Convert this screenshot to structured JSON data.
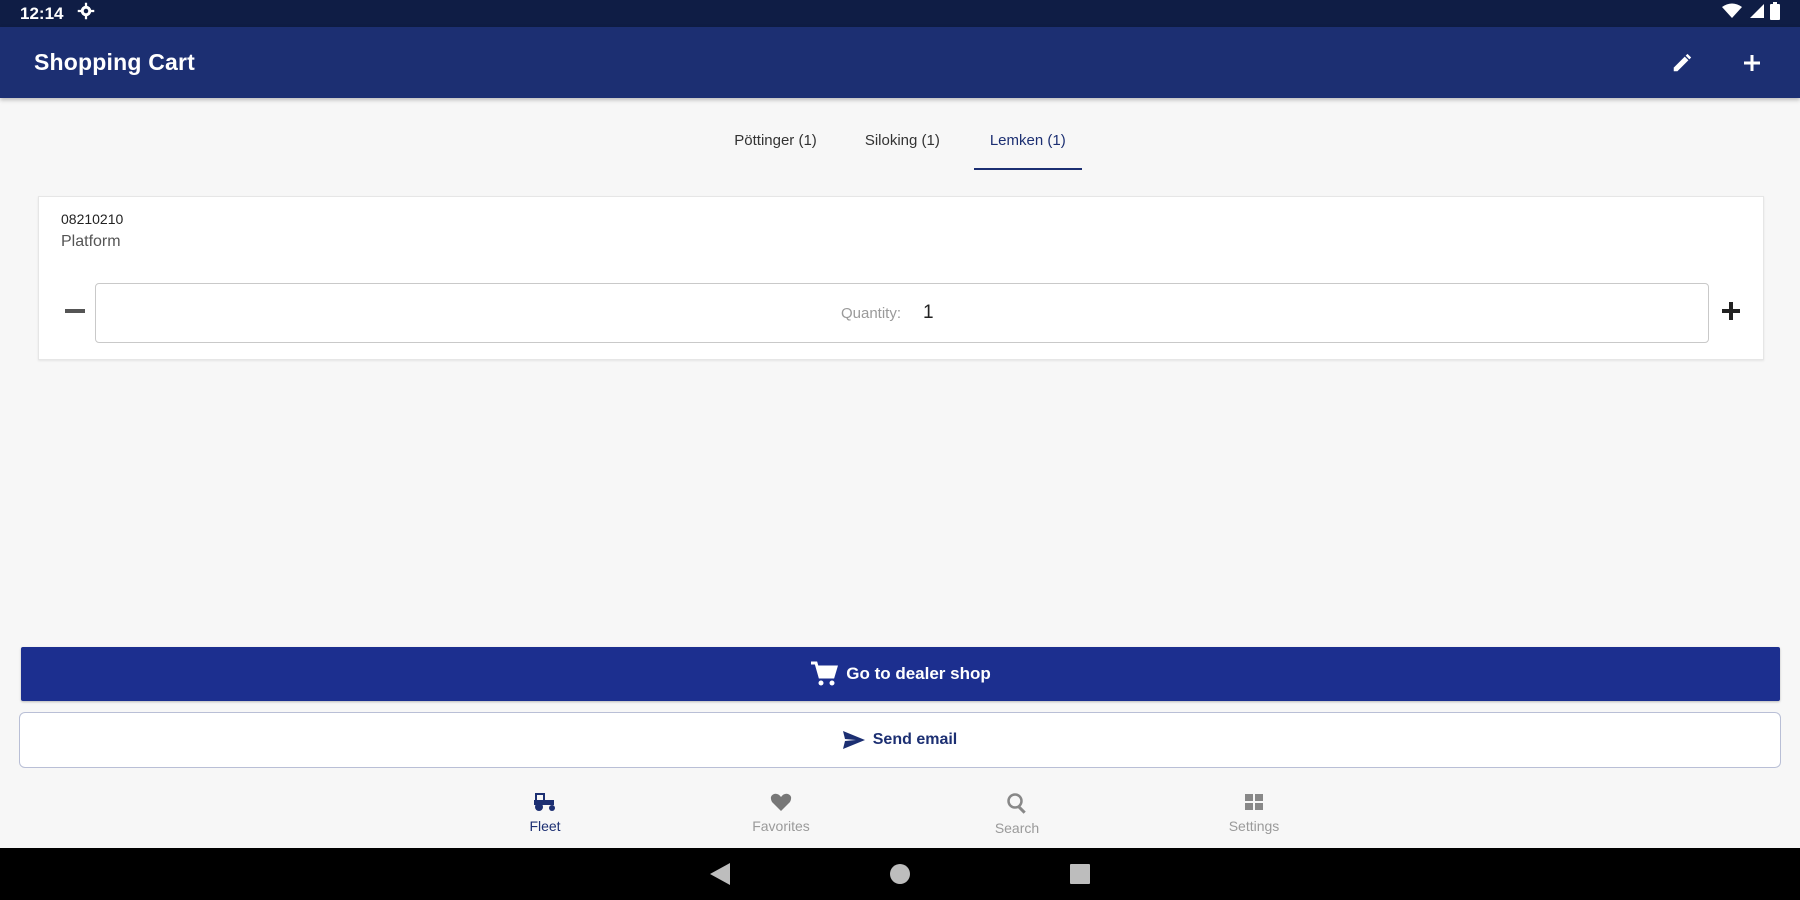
{
  "status_bar": {
    "time": "12:14",
    "settings_icon": "gear-icon",
    "wifi_icon": "wifi-icon",
    "signal_icon": "signal-icon",
    "battery_icon": "battery-icon"
  },
  "app_bar": {
    "title": "Shopping Cart",
    "edit_icon": "edit-icon",
    "add_icon": "plus-icon",
    "color": "#1c2f72"
  },
  "tabs": [
    {
      "label": "Pöttinger (1)",
      "active": false
    },
    {
      "label": "Siloking (1)",
      "active": false
    },
    {
      "label": "Lemken (1)",
      "active": true
    }
  ],
  "cart_item": {
    "part_number": "08210210",
    "part_name": "Platform",
    "quantity_label": "Quantity:",
    "quantity_value": "1"
  },
  "actions": {
    "dealer_shop_label": "Go to dealer shop",
    "dealer_shop_icon": "cart-icon",
    "send_email_label": "Send email",
    "send_email_icon": "send-icon"
  },
  "bottom_nav": [
    {
      "label": "Fleet",
      "icon": "tractor-icon",
      "active": true
    },
    {
      "label": "Favorites",
      "icon": "heart-icon",
      "active": false
    },
    {
      "label": "Search",
      "icon": "search-icon",
      "active": false
    },
    {
      "label": "Settings",
      "icon": "settings-icon",
      "active": false
    }
  ],
  "system_nav": {
    "back_icon": "back-icon",
    "home_icon": "home-icon",
    "recents_icon": "recents-icon"
  }
}
